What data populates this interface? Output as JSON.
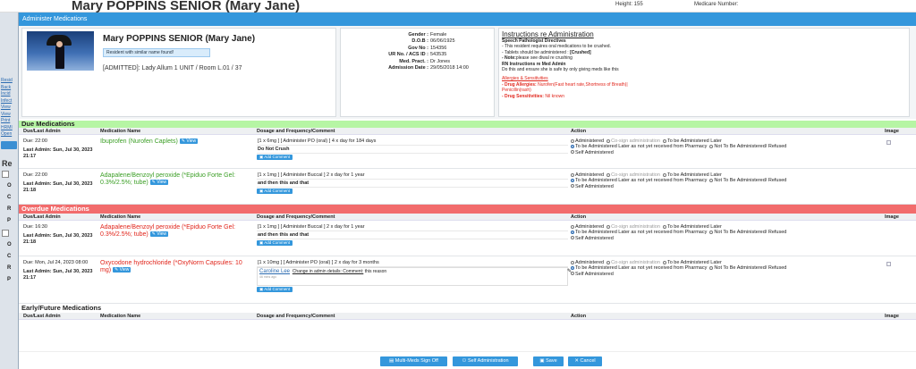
{
  "background": {
    "title": "Mary POPPINS SENIOR (Mary Jane)",
    "height_label": "Height: 155",
    "medicare_label": "Medicare Number:",
    "left_links": [
      "Resid",
      "Back",
      "Incid",
      "Infect",
      "View",
      "View",
      "Print",
      "HRMI",
      "Open"
    ],
    "left_letters": [
      "Re",
      "O",
      "C",
      "R",
      "P",
      "O",
      "C",
      "R",
      "P"
    ]
  },
  "modal": {
    "title": "Administer Medications"
  },
  "patient": {
    "name": "Mary POPPINS SENIOR (Mary Jane)",
    "similar_notice": "Resident with similar name found!",
    "admitted": "[ADMITTED]: Lady Allum 1 UNIT / Room L.01 / 37",
    "details": [
      {
        "k": "Gender :",
        "v": "Female"
      },
      {
        "k": "D.O.B :",
        "v": "06/06/1925"
      },
      {
        "k": "Gov No :",
        "v": "154356"
      },
      {
        "k": "UR No. / ACS ID :",
        "v": "543535"
      },
      {
        "k": "Med. Pract. :",
        "v": "Dr Jones"
      },
      {
        "k": "Admission Date :",
        "v": "29/05/2018 14:00"
      }
    ]
  },
  "instructions": {
    "heading": "Instructions re Administration",
    "speech_heading": "Speech Pathologist Directives",
    "line1": "- This resident requires oral medications to be crushed.",
    "line2a": "- Tablets should be administered : ",
    "line2b": "[Crushed]",
    "line3a": "- Note:",
    "line3b": "please see diwal re crushing",
    "rn_heading": "RN Instructions re Med Admin",
    "rn_line": "Do this and ensure she is safe by only giving meds like this",
    "allergy_heading": "Allergies & Sensitivities",
    "allergy_label": "- Drug Allergies:",
    "allergy_value": " Nurofen(Fast heart rate,Shortness of Breath)|",
    "allergy_value2": "Penicillin(rash)",
    "sens_label": "- Drug Sensitivities:",
    "sens_value": " Nil known"
  },
  "columns": [
    "Due/Last Admin",
    "Medication Name",
    "Dosage and Frequency/Comment",
    "Action",
    "Image"
  ],
  "action_options": {
    "administered": "Administered",
    "cosign": "Co-sign administration",
    "later": "To be Administered Later",
    "later_pharmacy": "To be Administered Later as not yet received from Pharmacy",
    "not_admin": "Not To Be Administered/ Refused",
    "self": "Self Administered"
  },
  "view_label": "View",
  "add_comment_label": "Add Comment",
  "sections": {
    "due": {
      "title": "Due Medications",
      "rows": [
        {
          "due": "Due: 22:00",
          "last": "Last Admin: Sun, Jul 30, 2023 21:17",
          "med": "Ibuprofen (Nurofen Caplets)",
          "dose": "[1 x 6mg ]  [ Administer PO (oral) ]  4 x day for 184 days",
          "comment": "Do Not Crush"
        },
        {
          "due": "Due: 22:00",
          "last": "Last Admin: Sun, Jul 30, 2023 21:18",
          "med": "Adapalene/Benzoyl peroxide (*Epiduo Forte Gel: 0.3%/2.5%; tube)",
          "dose": "[1 x 1mg ]  [ Administer Buccal ]  2 x day for 1 year",
          "comment": "and then this and that"
        }
      ]
    },
    "overdue": {
      "title": "Overdue Medications",
      "rows": [
        {
          "due": "Due: 16:30",
          "last": "Last Admin: Sun, Jul 30, 2023 21:18",
          "med": "Adapalene/Benzoyl peroxide (*Epiduo Forte Gel: 0.3%/2.5%; tube)",
          "dose": "[1 x 1mg ]  [ Administer Buccal ]  2 x day for 1 year",
          "comment": "and then this and that"
        },
        {
          "due": "Due: Mon, Jul 24, 2023 08:00",
          "last": "Last Admin: Sun, Jul 30, 2023 21:17",
          "med": "Oxycodone hydrochloride (*OxyNorm Capsules: 10 mg)",
          "dose": "[1 x 10mg ]  [ Administer PO (oral) ]  2 x day for 3 months",
          "comment_author": "Caroline Lee",
          "comment_link": "Change in admin details: Comment:",
          "comment_text": " this reason",
          "comment_time": "46 mins ago"
        }
      ]
    },
    "future": {
      "title": "Early/Future Medications"
    }
  },
  "footer": {
    "multi": "Multi-Meds Sign Off",
    "self": "Self Administration",
    "save": "Save",
    "cancel": "Cancel"
  }
}
